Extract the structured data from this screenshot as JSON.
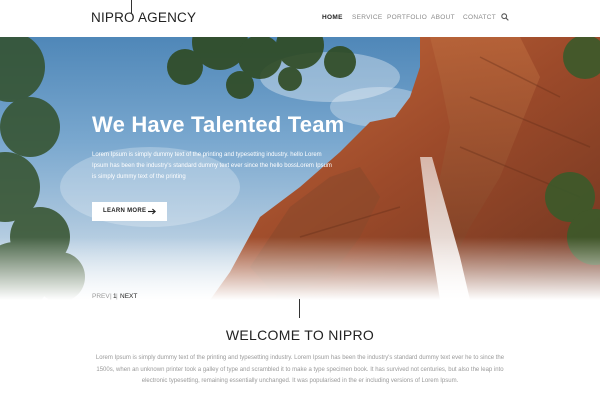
{
  "brand": {
    "name": "NIPRO AGENCY"
  },
  "nav": {
    "items": [
      "HOME",
      "SERVICE",
      "PORTFOLIO",
      "ABOUT",
      "CONATCT"
    ],
    "active_index": 0,
    "search_icon": "search-icon"
  },
  "hero": {
    "title": "We Have Talented Team",
    "text": "Lorem Ipsum is simply dummy text of the printing and typesetting industry. hello Lorem Ipsum has been the industry's standard dummy text ever since the  hello  bossLorem Ipsum is simply dummy text of the printing",
    "button_label": "LEARN MORE",
    "button_icon": "arrow-right-icon"
  },
  "pager": {
    "prev": "PREV",
    "separator_left": "|",
    "current": "1",
    "separator_right": "|",
    "next": "NEXT"
  },
  "welcome": {
    "title": "WELCOME TO NIPRO",
    "text": "Lorem Ipsum is simply dummy text of the printing and typesetting industry. Lorem Ipsum has been the industry's standard dummy text ever he to since the 1500s, when an unknown printer took a galley of type and scrambled it to make a type specimen book. It has survived not  centuries, but also the leap into electronic typesetting, remaining essentially unchanged. It was popularised in the er including versions of Lorem Ipsum."
  },
  "colors": {
    "text_dark": "#222222",
    "text_muted": "#9a9a9a",
    "hero_sky": "#6b9dc7",
    "rock": "#a0522d"
  }
}
